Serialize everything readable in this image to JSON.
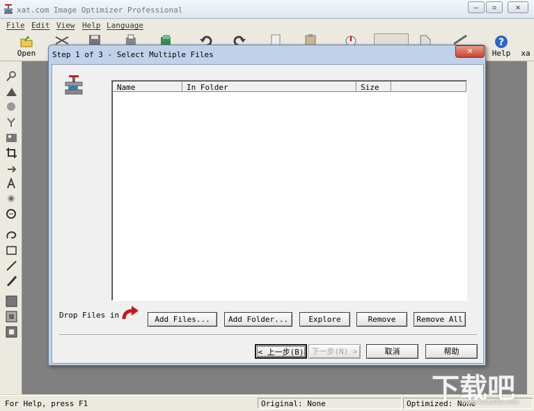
{
  "app": {
    "title": "xat.com  Image Optimizer Professional"
  },
  "window_controls": {
    "minimize": "—",
    "maximize": "▫",
    "close": "✕"
  },
  "menu": [
    "File",
    "Edit",
    "View",
    "Help",
    "Language"
  ],
  "toolbar": {
    "open": "Open",
    "help": "Help",
    "xat": "xa"
  },
  "tools": [
    "zoom-icon",
    "mountain-icon",
    "sphere-icon",
    "tone-icon",
    "image-icon",
    "crop-icon",
    "rotate-icon",
    "text-icon",
    "flower-icon",
    "stamp-icon",
    "lasso-icon",
    "rectangle-icon",
    "line-icon",
    "brush-icon",
    "color-fill-icon",
    "mask-icon",
    "selection-icon"
  ],
  "dialog": {
    "title": "Step 1 of 3 - Select Multiple Files",
    "close": "✕",
    "columns": [
      "Name",
      "In Folder",
      "Size"
    ],
    "drop_label": "Drop Files in",
    "buttons": {
      "add_files": "Add Files...",
      "add_folder": "Add Folder...",
      "explore": "Explore",
      "remove": "Remove",
      "remove_all": "Remove All"
    },
    "nav": {
      "back": "< 上一步(B)",
      "next": "下一步(N) >",
      "cancel": "取消",
      "help": "帮助"
    }
  },
  "status": {
    "help": "For Help, press F1",
    "original": "Original: None",
    "optimized": "Optimized: None"
  },
  "watermark": {
    "main": "下载吧",
    "sub": "www.xiazaiba.com"
  }
}
